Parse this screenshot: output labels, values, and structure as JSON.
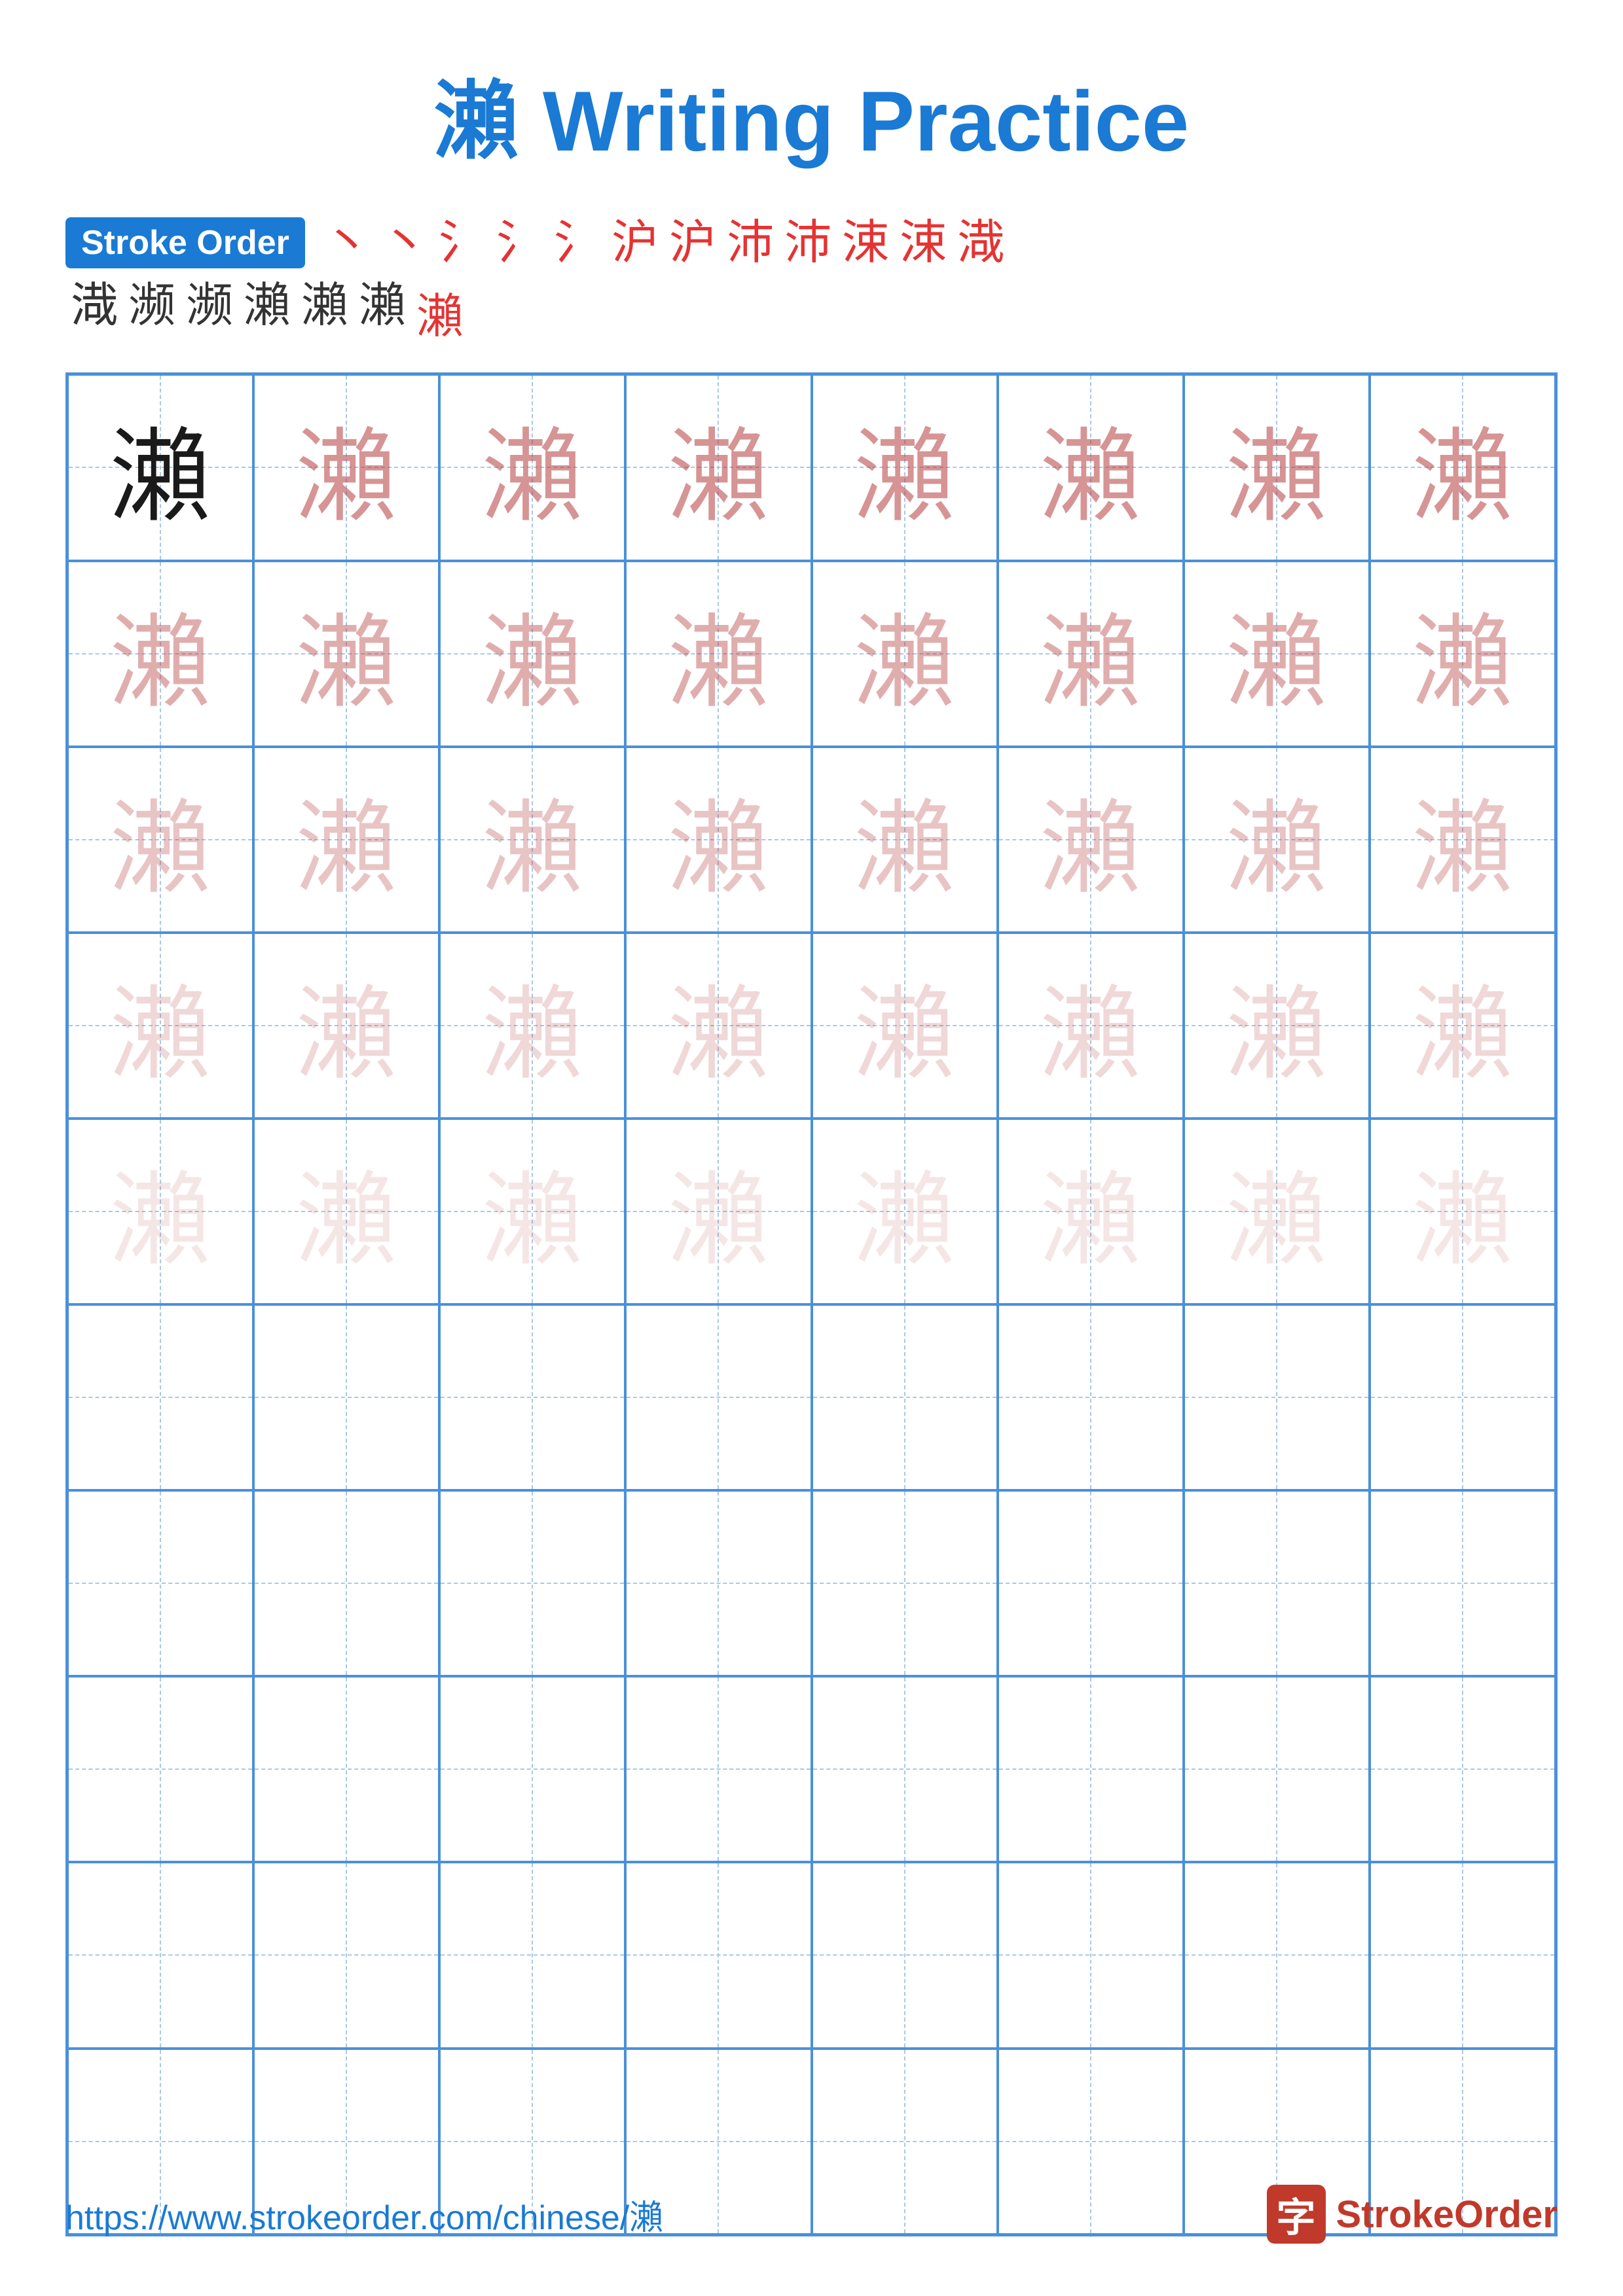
{
  "title": {
    "char": "瀨",
    "rest": " Writing Practice"
  },
  "stroke_order": {
    "badge_label": "Stroke Order",
    "strokes_row1": [
      "丶",
      "丶",
      "氵",
      "氵",
      "氵",
      "沪",
      "沪",
      "沛",
      "沛",
      "涑",
      "涑",
      "渽"
    ],
    "strokes_row2": [
      "渽",
      "濒",
      "濒",
      "瀨",
      "瀨",
      "瀨",
      "瀨"
    ]
  },
  "grid": {
    "rows": 10,
    "cols": 8,
    "char": "瀨",
    "practice_rows": [
      [
        "dark",
        "mid1",
        "mid1",
        "mid1",
        "mid1",
        "mid1",
        "mid1",
        "mid1"
      ],
      [
        "mid2",
        "mid2",
        "mid2",
        "mid2",
        "mid2",
        "mid2",
        "mid2",
        "mid2"
      ],
      [
        "mid3",
        "mid3",
        "mid3",
        "mid3",
        "mid3",
        "mid3",
        "mid3",
        "mid3"
      ],
      [
        "mid4",
        "mid4",
        "mid4",
        "mid4",
        "mid4",
        "mid4",
        "mid4",
        "mid4"
      ],
      [
        "light",
        "light",
        "light",
        "light",
        "light",
        "light",
        "light",
        "light"
      ],
      [
        "empty",
        "empty",
        "empty",
        "empty",
        "empty",
        "empty",
        "empty",
        "empty"
      ],
      [
        "empty",
        "empty",
        "empty",
        "empty",
        "empty",
        "empty",
        "empty",
        "empty"
      ],
      [
        "empty",
        "empty",
        "empty",
        "empty",
        "empty",
        "empty",
        "empty",
        "empty"
      ],
      [
        "empty",
        "empty",
        "empty",
        "empty",
        "empty",
        "empty",
        "empty",
        "empty"
      ],
      [
        "empty",
        "empty",
        "empty",
        "empty",
        "empty",
        "empty",
        "empty",
        "empty"
      ]
    ]
  },
  "footer": {
    "url": "https://www.strokeorder.com/chinese/瀨",
    "logo_char": "字",
    "logo_text_stroke": "Stroke",
    "logo_text_order": "Order"
  }
}
